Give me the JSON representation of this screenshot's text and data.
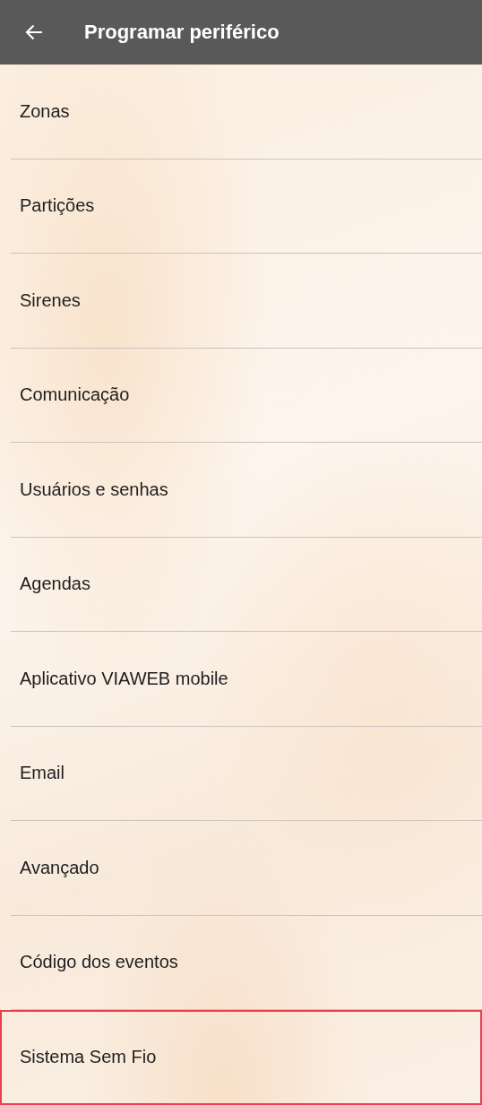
{
  "app_bar": {
    "back_icon": true,
    "title": "Programar periférico"
  },
  "menu_items": [
    {
      "label": "Zonas",
      "selected": false
    },
    {
      "label": "Partições",
      "selected": false
    },
    {
      "label": "Sirenes",
      "selected": false
    },
    {
      "label": "Comunicação",
      "selected": false
    },
    {
      "label": "Usuários e senhas",
      "selected": false
    },
    {
      "label": "Agendas",
      "selected": false
    },
    {
      "label": "Aplicativo VIAWEB mobile",
      "selected": false
    },
    {
      "label": "Email",
      "selected": false
    },
    {
      "label": "Avançado",
      "selected": false
    },
    {
      "label": "Código dos eventos",
      "selected": false
    },
    {
      "label": "Sistema Sem Fio",
      "selected": true
    }
  ]
}
